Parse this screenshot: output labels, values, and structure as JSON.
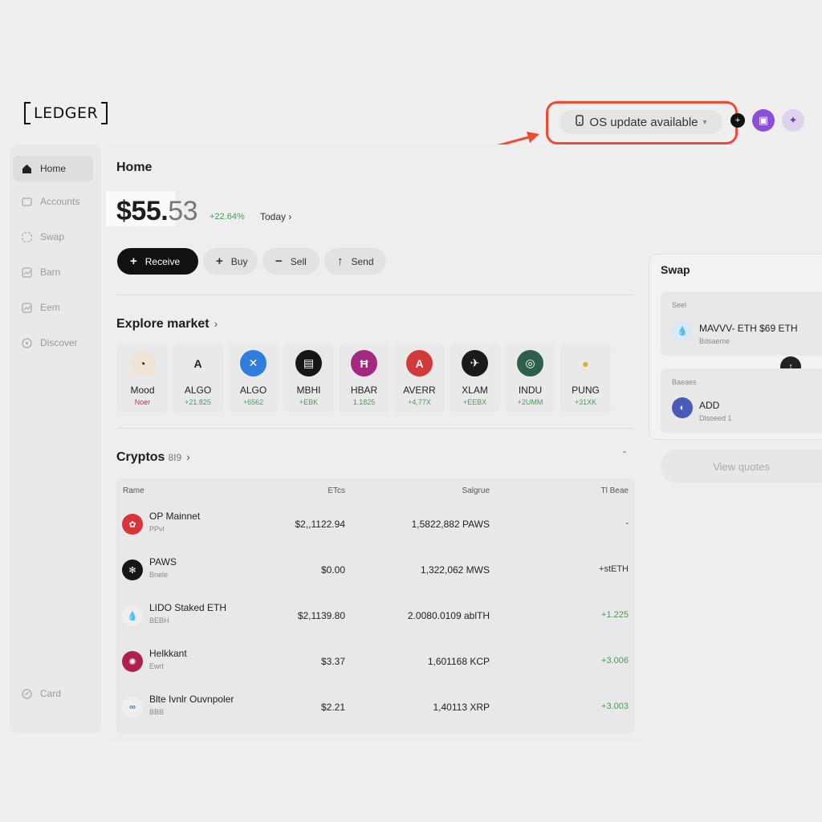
{
  "brand": {
    "logo_text": "LEDGER"
  },
  "header": {
    "os_update_label": "OS update available",
    "annotation_color": "#ef4b34"
  },
  "sidebar": {
    "items": [
      {
        "label": "Home",
        "icon": "home-icon"
      },
      {
        "label": "Accounts",
        "icon": "wallet-icon"
      },
      {
        "label": "Swap",
        "icon": "swap-icon"
      },
      {
        "label": "Barn",
        "icon": "chart-icon"
      },
      {
        "label": "Eem",
        "icon": "chart-icon"
      },
      {
        "label": "Discover",
        "icon": "compass-icon"
      }
    ],
    "card_label": "Card"
  },
  "main": {
    "title": "Home",
    "balance_main": "$55.",
    "balance_cents": "53",
    "change": "+22.64%",
    "period": "Today",
    "actions": [
      {
        "label": "Receive",
        "symbol": "+"
      },
      {
        "label": "Buy",
        "symbol": "+"
      },
      {
        "label": "Sell",
        "symbol": "−"
      },
      {
        "label": "Send",
        "symbol": "↑"
      }
    ]
  },
  "market": {
    "title": "Explore market",
    "items": [
      {
        "symbol": "Mood",
        "change": "Noer",
        "color": "#efe6d6",
        "glyph": "◔"
      },
      {
        "symbol": "ALGO",
        "change": "+21.825",
        "color": "#e9e9e9",
        "glyph": "A"
      },
      {
        "symbol": "ALGO",
        "change": "+6562",
        "color": "#2f7ddd",
        "glyph": "✕"
      },
      {
        "symbol": "MBHI",
        "change": "+EBK",
        "color": "#161616",
        "glyph": "▤"
      },
      {
        "symbol": "HBAR",
        "change": "1.1825",
        "color": "#a3287f",
        "glyph": "Ħ"
      },
      {
        "symbol": "AVERR",
        "change": "+4,77X",
        "color": "#d13a3a",
        "glyph": "A"
      },
      {
        "symbol": "XLAM",
        "change": "+EEBX",
        "color": "#1a1a1a",
        "glyph": "✈"
      },
      {
        "symbol": "INDU",
        "change": "+2UMM",
        "color": "#2e5f4a",
        "glyph": "◎"
      },
      {
        "symbol": "PUNG",
        "change": "+31XK",
        "color": "#e9e9e9",
        "glyph": "●"
      }
    ]
  },
  "cryptos": {
    "title": "Cryptos",
    "count": "8I9",
    "columns": {
      "name": "Rame",
      "price": "ETcs",
      "balance": "Salgrue",
      "change": "Tl Beae"
    },
    "rows": [
      {
        "name": "OP Mainnet",
        "sub": "PPvl",
        "price": "$2,,1122.94",
        "balance": "1,5822,882 PAWS",
        "change": "-",
        "color": "#d8343a",
        "glyph": "✿",
        "green": false
      },
      {
        "name": "PAWS",
        "sub": "Bnele",
        "price": "$0.00",
        "balance": "1,322,062 MWS",
        "change": "+stETH",
        "color": "#161616",
        "glyph": "✻",
        "green": false
      },
      {
        "name": "LIDO Staked ETH",
        "sub": "BEBH",
        "price": "$2,1139.80",
        "balance": "2.0080.0109 ablTH",
        "change": "+1.225",
        "color": "#efefef",
        "glyph": "💧",
        "green": true
      },
      {
        "name": "Helkkant",
        "sub": "Ewrt",
        "price": "$3.37",
        "balance": "1,601168 KCP",
        "change": "+3.006",
        "color": "#b0204f",
        "glyph": "✺",
        "green": true
      },
      {
        "name": "Blte Ivnlr Ouvnpoler",
        "sub": "BBB",
        "price": "$2.21",
        "balance": "1,40113 XRP",
        "change": "+3.003",
        "color": "#efefef",
        "glyph": "∞",
        "green": true
      }
    ]
  },
  "swap": {
    "title": "Swap",
    "from_label": "Seel",
    "from_token": "MAVVV- ETH $69 ETH",
    "from_sub": "Bdsaeme",
    "to_label": "Baeaes",
    "to_token": "ADD",
    "to_sub": "Dlsoeed 1",
    "quotes_label": "View quotes"
  }
}
